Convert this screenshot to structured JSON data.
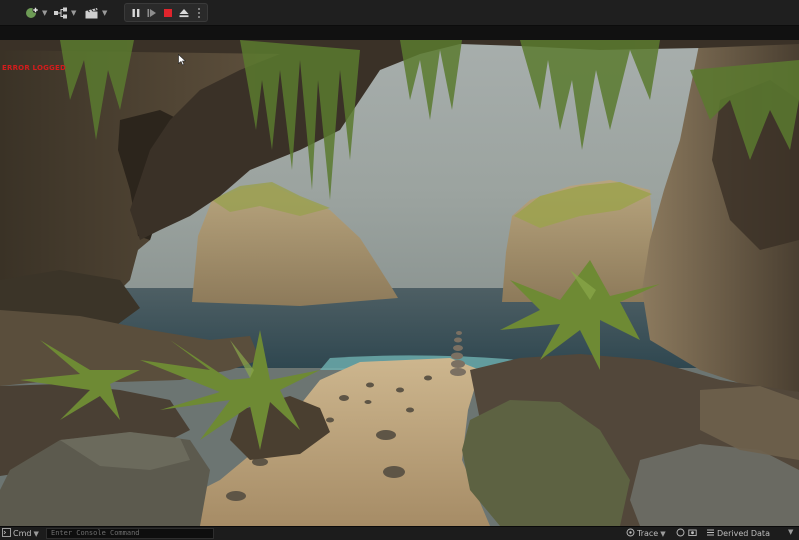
{
  "toolbar": {
    "icons": [
      "add-content-icon",
      "blueprint-graph-icon",
      "cinematics-clapper-icon"
    ],
    "play_controls": [
      "pause-icon",
      "skip-frame-icon",
      "stop-icon",
      "eject-icon",
      "more-options-icon"
    ],
    "colors": {
      "stop": "#e0242c",
      "bar": "#1f1f1f"
    }
  },
  "viewport": {
    "debug_text": "ERROR LOGGED",
    "debug_text_color": "#d31c1c"
  },
  "statusbar": {
    "cmd_label": "Cmd",
    "console_placeholder": "Enter Console Command",
    "trace_label": "Trace",
    "derived_data_label": "Derived Data"
  }
}
